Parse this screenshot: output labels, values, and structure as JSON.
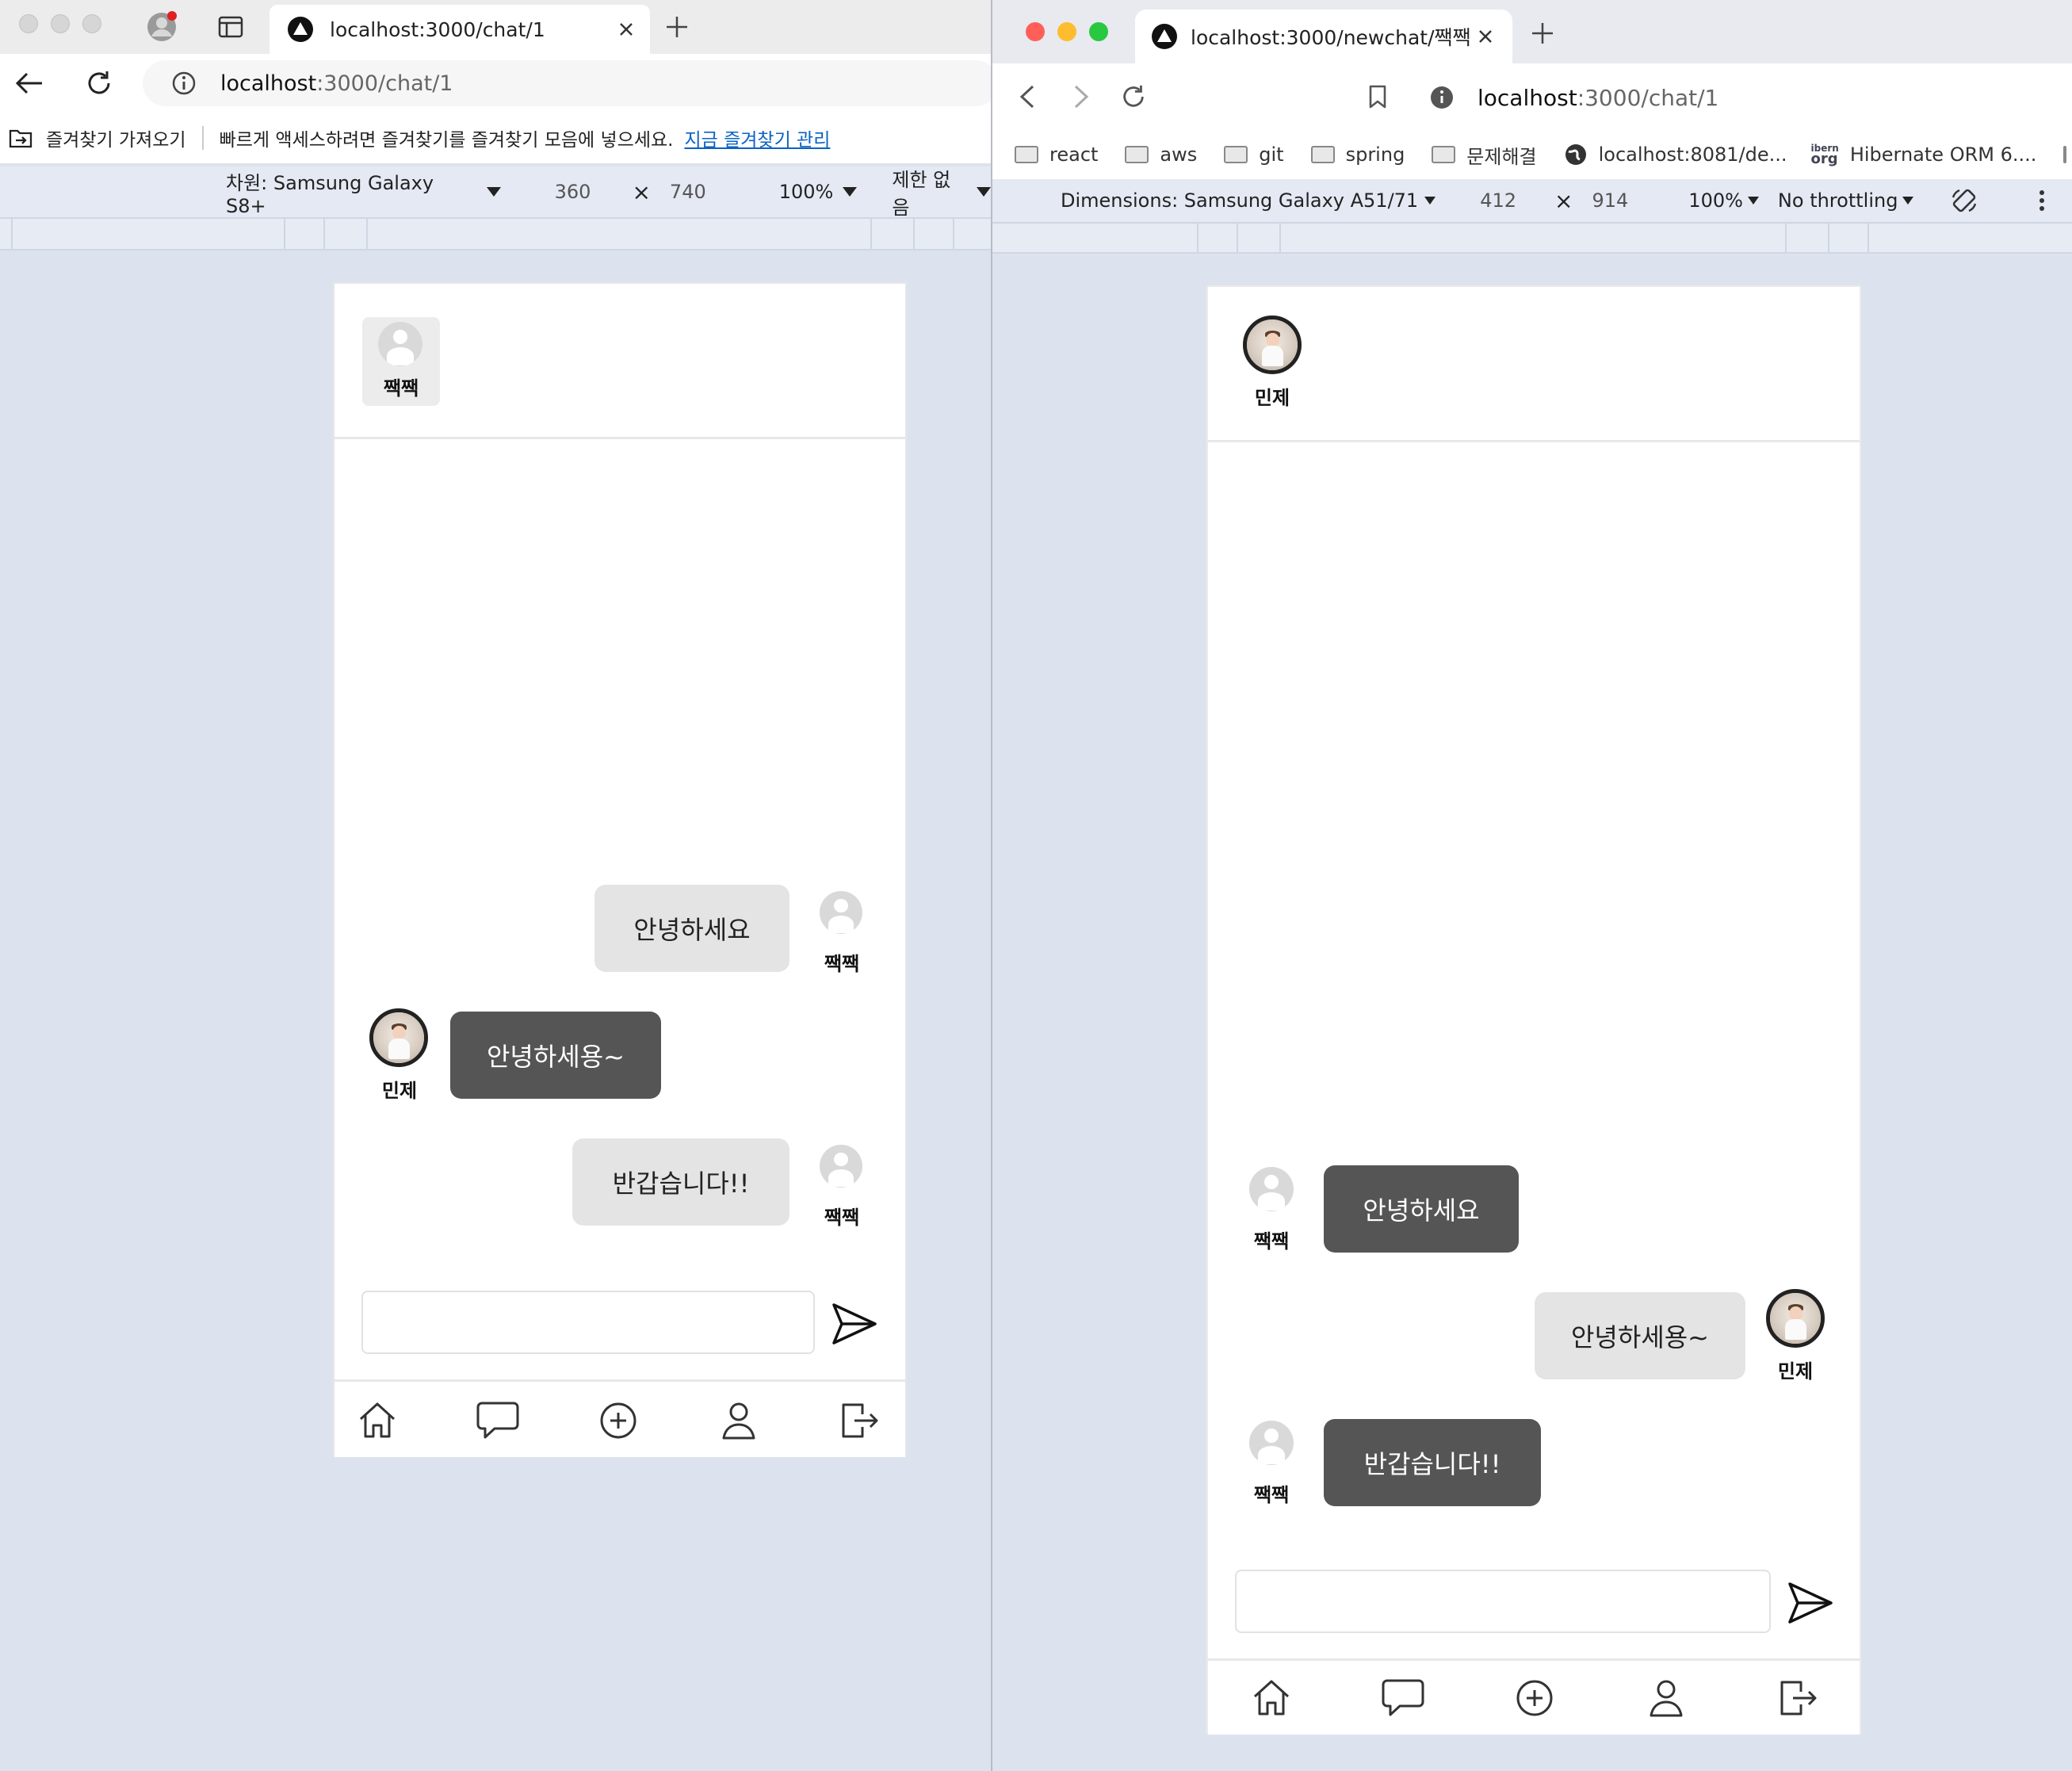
{
  "left": {
    "tab_title": "localhost:3000/chat/1",
    "address": {
      "host": "localhost",
      "rest": ":3000/chat/1"
    },
    "favorites": {
      "import": "즐겨찾기 가져오기",
      "hint": "빠르게 액세스하려면 즐겨찾기를 즐겨찾기 모음에 넣으세요.",
      "manage": "지금 즐겨찾기 관리"
    },
    "devtools": {
      "device": "차원: Samsung Galaxy S8+",
      "width": "360",
      "x": "×",
      "height": "740",
      "zoom": "100%",
      "throttle": "제한 없음"
    },
    "chat": {
      "header_user": "짹짹",
      "messages": [
        {
          "text": "안녕하세요",
          "user": "짹짹"
        },
        {
          "text": "안녕하세용~",
          "user": "민제"
        },
        {
          "text": "반갑습니다!!",
          "user": "짹짹"
        }
      ]
    }
  },
  "right": {
    "tab_title": "localhost:3000/newchat/짹짹",
    "address": {
      "host": "localhost",
      "rest": ":3000/chat/1"
    },
    "bookmarks": [
      "react",
      "aws",
      "git",
      "spring",
      "문제해결",
      "localhost:8081/de...",
      "Hibernate ORM 6...."
    ],
    "bookmark_icon_labels": {
      "hibernate_top": "ibern",
      "hibernate_bottom": "org"
    },
    "devtools": {
      "device": "Dimensions: Samsung Galaxy A51/71",
      "width": "412",
      "x": "×",
      "height": "914",
      "zoom": "100%",
      "throttle": "No throttling"
    },
    "chat": {
      "header_user": "민제",
      "messages": [
        {
          "text": "안녕하세요",
          "user": "짹짹"
        },
        {
          "text": "안녕하세용~",
          "user": "민제"
        },
        {
          "text": "반갑습니다!!",
          "user": "짹짹"
        }
      ]
    }
  },
  "colors": {
    "bubble_light": "#e4e4e4",
    "bubble_dark": "#555555",
    "link": "#0b62c4",
    "mac_red": "#ff5f57",
    "mac_yellow": "#febc2e",
    "mac_green": "#28c840"
  },
  "icons": [
    "profile-icon",
    "tabs-icon",
    "close-icon",
    "plus-icon",
    "back-icon",
    "forward-icon",
    "reload-icon",
    "info-icon",
    "bookmark-icon",
    "folder-icon",
    "globe-icon",
    "send-icon",
    "home-icon",
    "chat-icon",
    "add-circle-icon",
    "user-icon",
    "logout-icon",
    "rotate-icon",
    "more-icon"
  ]
}
